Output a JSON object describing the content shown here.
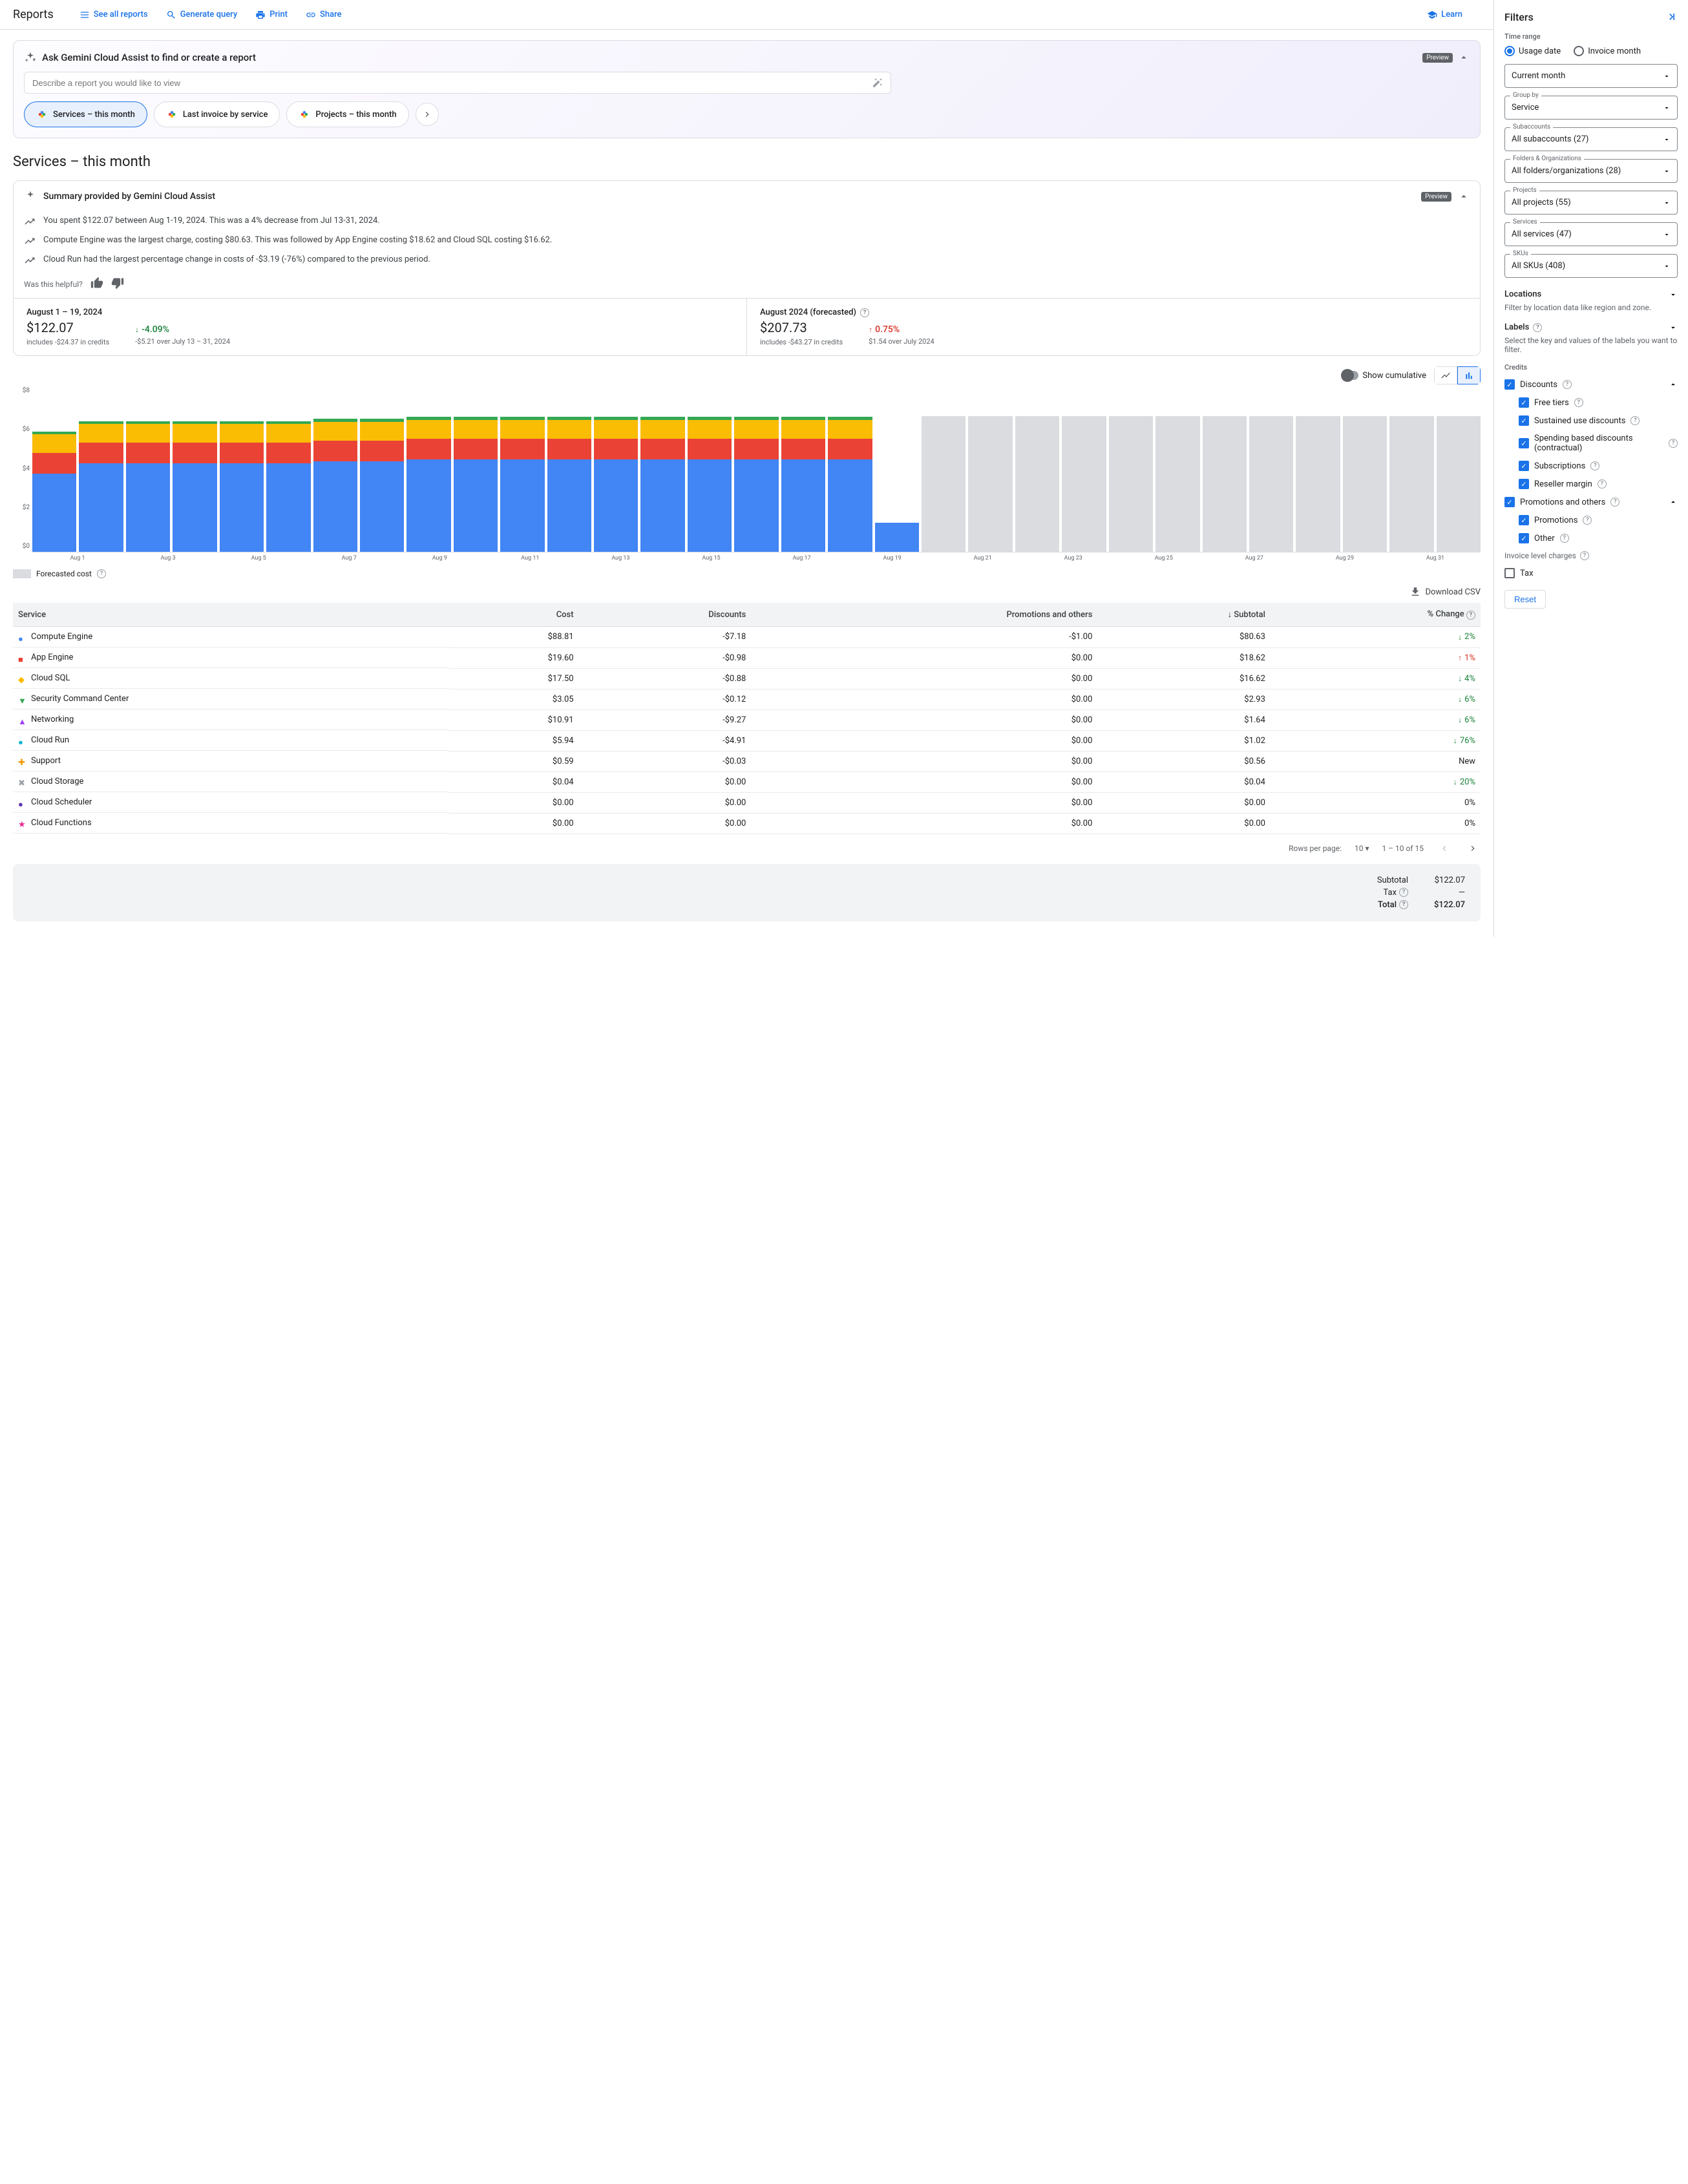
{
  "header": {
    "title": "Reports",
    "links": {
      "see_all": "See all reports",
      "generate": "Generate query",
      "print": "Print",
      "share": "Share",
      "learn": "Learn"
    }
  },
  "gemini": {
    "title": "Ask Gemini Cloud Assist to find or create a report",
    "badge": "Preview",
    "placeholder": "Describe a report you would like to view",
    "chips": [
      "Services – this month",
      "Last invoice by service",
      "Projects – this month"
    ]
  },
  "page_title": "Services – this month",
  "summary": {
    "heading": "Summary provided by Gemini Cloud Assist",
    "badge": "Preview",
    "bullets": [
      "You spent $122.07 between Aug 1-19, 2024. This was a 4% decrease from Jul 13-31, 2024.",
      "Compute Engine was the largest charge, costing $80.63. This was followed by App Engine costing $18.62 and Cloud SQL costing $16.62.",
      "Cloud Run had the largest percentage change in costs of -$3.19 (-76%) compared to the previous period."
    ],
    "helpful": "Was this helpful?"
  },
  "stats": {
    "left": {
      "label": "August 1 – 19, 2024",
      "value": "$122.07",
      "credits": "includes -$24.37 in credits",
      "change": "-4.09%",
      "change_dir": "down",
      "change_sub": "-$5.21 over July 13 – 31, 2024"
    },
    "right": {
      "label": "August 2024 (forecasted)",
      "value": "$207.73",
      "credits": "includes -$43.27 in credits",
      "change": "0.75%",
      "change_dir": "up",
      "change_sub": "$1.54 over July 2024"
    }
  },
  "chart_controls": {
    "cumulative": "Show cumulative"
  },
  "chart_data": {
    "type": "bar",
    "ylabel": "$",
    "ylim": [
      0,
      8
    ],
    "yticks": [
      "$8",
      "$6",
      "$4",
      "$2",
      "$0"
    ],
    "categories": [
      "Aug 1",
      "Aug 2",
      "Aug 3",
      "Aug 4",
      "Aug 5",
      "Aug 6",
      "Aug 7",
      "Aug 8",
      "Aug 9",
      "Aug 10",
      "Aug 11",
      "Aug 12",
      "Aug 13",
      "Aug 14",
      "Aug 15",
      "Aug 16",
      "Aug 17",
      "Aug 18",
      "Aug 19",
      "Aug 20",
      "Aug 21",
      "Aug 22",
      "Aug 23",
      "Aug 24",
      "Aug 25",
      "Aug 26",
      "Aug 27",
      "Aug 28",
      "Aug 29",
      "Aug 30",
      "Aug 31"
    ],
    "x_tick_labels": [
      "Aug 1",
      "Aug 3",
      "Aug 5",
      "Aug 7",
      "Aug 9",
      "Aug 11",
      "Aug 13",
      "Aug 15",
      "Aug 17",
      "Aug 19",
      "Aug 21",
      "Aug 23",
      "Aug 25",
      "Aug 27",
      "Aug 29",
      "Aug 31"
    ],
    "series": [
      {
        "name": "Compute Engine",
        "color": "#4285f4",
        "values": [
          3.8,
          4.3,
          4.3,
          4.3,
          4.3,
          4.3,
          4.4,
          4.4,
          4.5,
          4.5,
          4.5,
          4.5,
          4.5,
          4.5,
          4.5,
          4.5,
          4.5,
          4.5,
          1.4,
          0,
          0,
          0,
          0,
          0,
          0,
          0,
          0,
          0,
          0,
          0,
          0
        ]
      },
      {
        "name": "App Engine",
        "color": "#ea4335",
        "values": [
          1.0,
          1.0,
          1.0,
          1.0,
          1.0,
          1.0,
          1.0,
          1.0,
          1.0,
          1.0,
          1.0,
          1.0,
          1.0,
          1.0,
          1.0,
          1.0,
          1.0,
          1.0,
          0.0,
          0,
          0,
          0,
          0,
          0,
          0,
          0,
          0,
          0,
          0,
          0,
          0
        ]
      },
      {
        "name": "Cloud SQL",
        "color": "#fbbc04",
        "values": [
          0.9,
          0.9,
          0.9,
          0.9,
          0.9,
          0.9,
          0.9,
          0.9,
          0.9,
          0.9,
          0.9,
          0.9,
          0.9,
          0.9,
          0.9,
          0.9,
          0.9,
          0.9,
          0.0,
          0,
          0,
          0,
          0,
          0,
          0,
          0,
          0,
          0,
          0,
          0,
          0
        ]
      },
      {
        "name": "Other",
        "color": "#34a853",
        "values": [
          0.15,
          0.15,
          0.15,
          0.15,
          0.15,
          0.15,
          0.15,
          0.15,
          0.15,
          0.15,
          0.15,
          0.15,
          0.15,
          0.15,
          0.15,
          0.15,
          0.15,
          0.15,
          0.0,
          0,
          0,
          0,
          0,
          0,
          0,
          0,
          0,
          0,
          0,
          0,
          0
        ]
      }
    ],
    "forecast": [
      0,
      0,
      0,
      0,
      0,
      0,
      0,
      0,
      0,
      0,
      0,
      0,
      0,
      0,
      0,
      0,
      0,
      0,
      0,
      6.6,
      6.6,
      6.6,
      6.6,
      6.6,
      6.6,
      6.6,
      6.6,
      6.6,
      6.6,
      6.6,
      6.6
    ],
    "legend": "Forecasted cost"
  },
  "download": "Download CSV",
  "table": {
    "headers": [
      "Service",
      "Cost",
      "Discounts",
      "Promotions and others",
      "Subtotal",
      "% Change"
    ],
    "subtotal_sort": "down",
    "rows": [
      {
        "bullet": "●",
        "color": "#4285f4",
        "service": "Compute Engine",
        "cost": "$88.81",
        "discounts": "-$7.18",
        "promo": "-$1.00",
        "subtotal": "$80.63",
        "change": "2%",
        "dir": "down"
      },
      {
        "bullet": "■",
        "color": "#ea4335",
        "service": "App Engine",
        "cost": "$19.60",
        "discounts": "-$0.98",
        "promo": "$0.00",
        "subtotal": "$18.62",
        "change": "1%",
        "dir": "up"
      },
      {
        "bullet": "◆",
        "color": "#fbbc04",
        "service": "Cloud SQL",
        "cost": "$17.50",
        "discounts": "-$0.88",
        "promo": "$0.00",
        "subtotal": "$16.62",
        "change": "4%",
        "dir": "down"
      },
      {
        "bullet": "▼",
        "color": "#34a853",
        "service": "Security Command Center",
        "cost": "$3.05",
        "discounts": "-$0.12",
        "promo": "$0.00",
        "subtotal": "$2.93",
        "change": "6%",
        "dir": "down"
      },
      {
        "bullet": "▲",
        "color": "#a142f4",
        "service": "Networking",
        "cost": "$10.91",
        "discounts": "-$9.27",
        "promo": "$0.00",
        "subtotal": "$1.64",
        "change": "6%",
        "dir": "down"
      },
      {
        "bullet": "●",
        "color": "#12b5cb",
        "service": "Cloud Run",
        "cost": "$5.94",
        "discounts": "-$4.91",
        "promo": "$0.00",
        "subtotal": "$1.02",
        "change": "76%",
        "dir": "down"
      },
      {
        "bullet": "✚",
        "color": "#f29900",
        "service": "Support",
        "cost": "$0.59",
        "discounts": "-$0.03",
        "promo": "$0.00",
        "subtotal": "$0.56",
        "change": "New",
        "dir": "none"
      },
      {
        "bullet": "✖",
        "color": "#9aa0a6",
        "service": "Cloud Storage",
        "cost": "$0.04",
        "discounts": "$0.00",
        "promo": "$0.00",
        "subtotal": "$0.04",
        "change": "20%",
        "dir": "down"
      },
      {
        "bullet": "●",
        "color": "#5e35b1",
        "service": "Cloud Scheduler",
        "cost": "$0.00",
        "discounts": "$0.00",
        "promo": "$0.00",
        "subtotal": "$0.00",
        "change": "0%",
        "dir": "none"
      },
      {
        "bullet": "★",
        "color": "#e52592",
        "service": "Cloud Functions",
        "cost": "$0.00",
        "discounts": "$0.00",
        "promo": "$0.00",
        "subtotal": "$0.00",
        "change": "0%",
        "dir": "none"
      }
    ]
  },
  "pager": {
    "rows_label": "Rows per page:",
    "rows_value": "10",
    "range": "1 – 10 of 15"
  },
  "totals": {
    "subtotal_label": "Subtotal",
    "subtotal_value": "$122.07",
    "tax_label": "Tax",
    "tax_value": "—",
    "total_label": "Total",
    "total_value": "$122.07"
  },
  "filters": {
    "title": "Filters",
    "time_range": "Time range",
    "usage_date": "Usage date",
    "invoice_month": "Invoice month",
    "current_month": "Current month",
    "group_by_label": "Group by",
    "group_by": "Service",
    "subaccounts_label": "Subaccounts",
    "subaccounts": "All subaccounts (27)",
    "folders_label": "Folders & Organizations",
    "folders": "All folders/organizations (28)",
    "projects_label": "Projects",
    "projects": "All projects (55)",
    "services_label": "Services",
    "services": "All services (47)",
    "skus_label": "SKUs",
    "skus": "All SKUs (408)",
    "locations": "Locations",
    "locations_desc": "Filter by location data like region and zone.",
    "labels": "Labels",
    "labels_desc": "Select the key and values of the labels you want to filter.",
    "credits": "Credits",
    "discounts": "Discounts",
    "free_tiers": "Free tiers",
    "sustained": "Sustained use discounts",
    "spending": "Spending based discounts (contractual)",
    "subscriptions": "Subscriptions",
    "reseller": "Reseller margin",
    "promotions_others": "Promotions and others",
    "promotions": "Promotions",
    "other": "Other",
    "invoice_charges": "Invoice level charges",
    "tax": "Tax",
    "reset": "Reset"
  }
}
